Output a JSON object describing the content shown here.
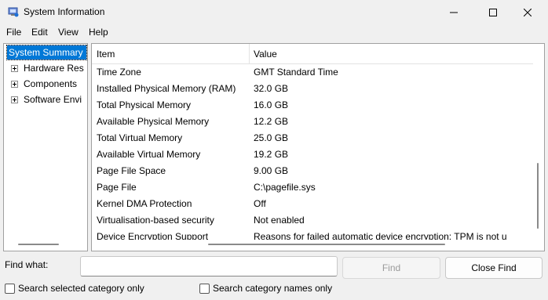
{
  "window": {
    "title": "System Information",
    "icon": "system-information-icon"
  },
  "menu": {
    "file": "File",
    "edit": "Edit",
    "view": "View",
    "help": "Help"
  },
  "tree": {
    "items": [
      {
        "label": "System Summary",
        "selected": true,
        "expandable": false
      },
      {
        "label": "Hardware Res",
        "selected": false,
        "expandable": true
      },
      {
        "label": "Components",
        "selected": false,
        "expandable": true
      },
      {
        "label": "Software Envi",
        "selected": false,
        "expandable": true
      }
    ]
  },
  "table": {
    "columns": {
      "item": "Item",
      "value": "Value"
    },
    "rows": [
      {
        "item": "Time Zone",
        "value": "GMT Standard Time"
      },
      {
        "item": "Installed Physical Memory (RAM)",
        "value": "32.0 GB"
      },
      {
        "item": "Total Physical Memory",
        "value": "16.0 GB"
      },
      {
        "item": "Available Physical Memory",
        "value": "12.2 GB"
      },
      {
        "item": "Total Virtual Memory",
        "value": "25.0 GB"
      },
      {
        "item": "Available Virtual Memory",
        "value": "19.2 GB"
      },
      {
        "item": "Page File Space",
        "value": "9.00 GB"
      },
      {
        "item": "Page File",
        "value": "C:\\pagefile.sys"
      },
      {
        "item": "Kernel DMA Protection",
        "value": "Off"
      },
      {
        "item": "Virtualisation-based security",
        "value": "Not enabled"
      },
      {
        "item": "Device Encryption Support",
        "value": "Reasons for failed automatic device encryption: TPM is not u"
      }
    ]
  },
  "find": {
    "label": "Find what:",
    "value": "",
    "find_button": "Find",
    "close_button": "Close Find",
    "search_selected": "Search selected category only",
    "search_names": "Search category names only"
  },
  "colors": {
    "selection": "#0078d7",
    "background": "#f0f0f0"
  }
}
